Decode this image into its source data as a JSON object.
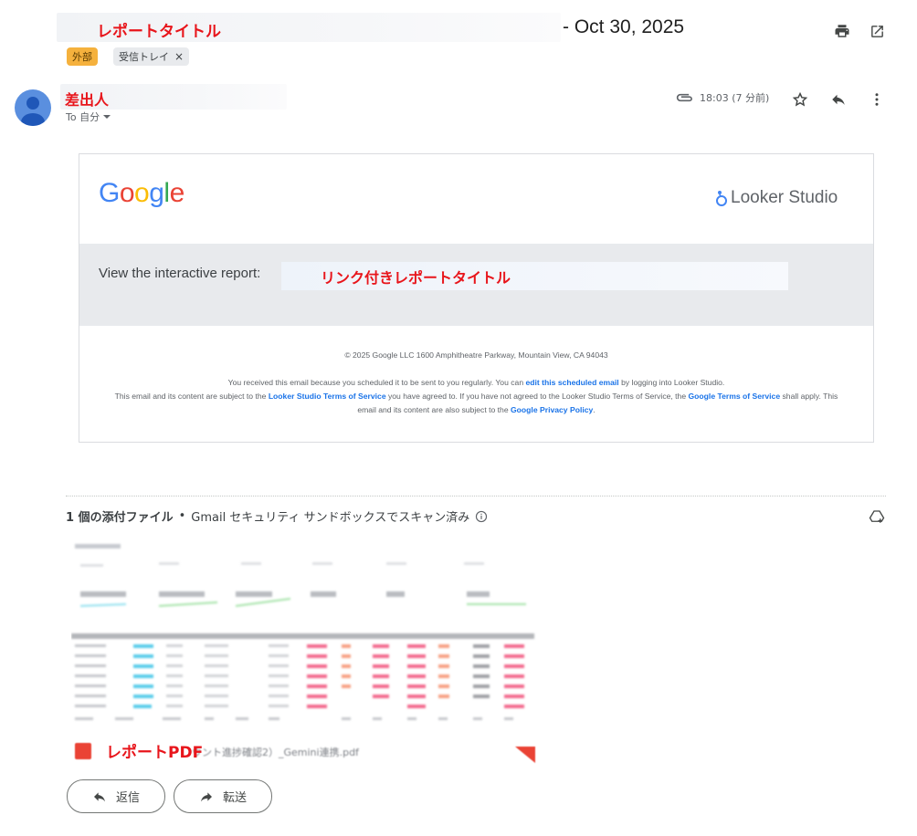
{
  "subject": {
    "annotation": "レポートタイトル",
    "date": "- Oct 30, 2025"
  },
  "header_actions": {
    "print_icon": "printer-icon",
    "popout_icon": "open-in-new-icon"
  },
  "labels": {
    "external": "外部",
    "inbox": "受信トレイ",
    "inbox_close": "×"
  },
  "sender": {
    "annotation": "差出人",
    "to_line": "To 自分",
    "time": "18:03 (7 分前)"
  },
  "card": {
    "google_logo": {
      "letters": [
        "G",
        "o",
        "o",
        "g",
        "l",
        "e"
      ],
      "colors": [
        "#4285F4",
        "#EA4335",
        "#FBBC05",
        "#4285F4",
        "#34A853",
        "#EA4335"
      ]
    },
    "looker_logo": "Looker Studio",
    "view_label": "View the interactive report:",
    "link_annotation": "リンク付きレポートタイトル",
    "copyright": "© 2025 Google LLC 1600 Amphitheatre Parkway, Mountain View, CA 94043",
    "notice1_pre": "You received this email because you scheduled it to be sent to you regularly. You can ",
    "notice1_link": "edit this scheduled email",
    "notice1_post": " by logging into Looker Studio.",
    "notice2_pre": "This email and its content are subject to the ",
    "notice2_link1": "Looker Studio Terms of Service",
    "notice2_mid": " you have agreed to. If you have not agreed to the Looker Studio Terms of Service, the ",
    "notice2_link2": "Google Terms of Service",
    "notice2_mid2": " shall apply. This email and its content are also subject to the ",
    "notice2_link3": "Google Privacy Policy",
    "notice2_end": "."
  },
  "attachments": {
    "count_label": "1 個の添付ファイル",
    "separator": "•",
    "scan_label": "Gmail セキュリティ サンドボックスでスキャン済み",
    "pdf_annotation": "レポートPDF",
    "pdf_name_blurred": "ウント進捗確認2）_Gemini連携.pdf"
  },
  "actions": {
    "reply": "返信",
    "forward": "転送"
  },
  "colors": {
    "annotation_red": "#e8151b",
    "link_blue": "#1a73e8",
    "chip_orange": "#f5b13d"
  }
}
